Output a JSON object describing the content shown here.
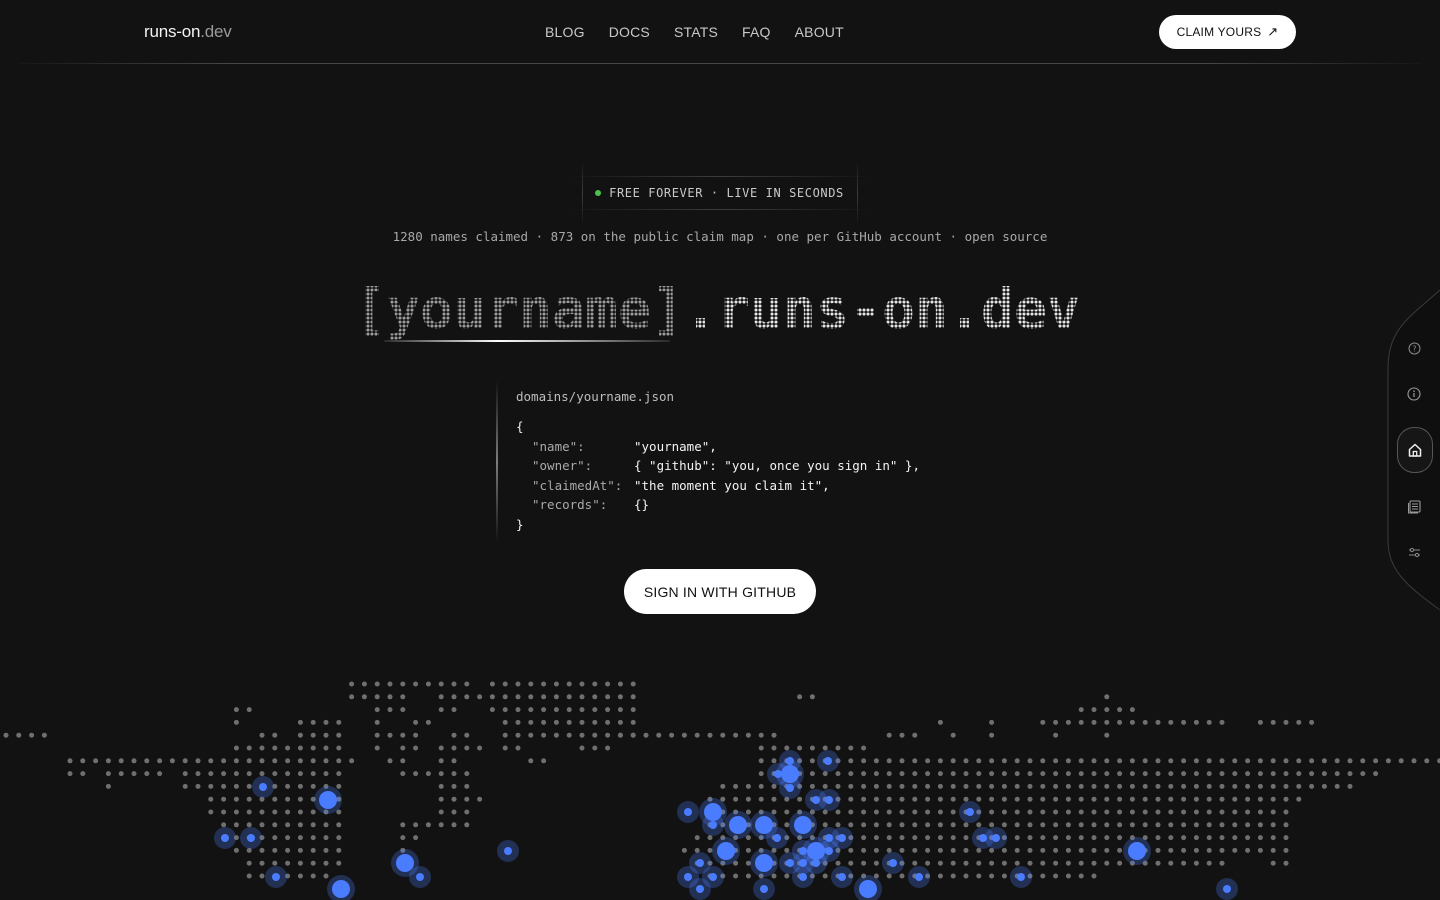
{
  "nav": {
    "logo_main": "runs-on",
    "logo_tld": ".dev",
    "links": [
      "BLOG",
      "DOCS",
      "STATS",
      "FAQ",
      "ABOUT"
    ],
    "cta_label": "CLAIM YOURS",
    "cta_icon": "arrow-up-right-icon"
  },
  "hero": {
    "badge_text": "FREE FOREVER · LIVE IN SECONDS",
    "badge_status_color": "#4cc24c",
    "stats_text": "1280 names claimed · 873 on the public claim map · one per GitHub account · open source",
    "title_placeholder": "[yourname]",
    "title_domain": ".runs-on.dev"
  },
  "code": {
    "filename": "domains/yourname.json",
    "open_brace": "{",
    "close_brace": "}",
    "rows": [
      {
        "key": "\"name\":",
        "value": "\"yourname\","
      },
      {
        "key": "\"owner\":",
        "value": "{ \"github\": \"you, once you sign in\" },"
      },
      {
        "key": "\"claimedAt\":",
        "value": "\"the moment you claim it\","
      },
      {
        "key": "\"records\":",
        "value": "{}"
      }
    ]
  },
  "cta": {
    "signin_label": "SIGN IN WITH GITHUB"
  },
  "rail": {
    "icons": [
      "help-circle-icon",
      "info-icon",
      "home-icon",
      "document-stack-icon",
      "settings-sliders-icon"
    ],
    "active": "home-icon"
  },
  "colors": {
    "background": "#121212",
    "accent_blue": "#4a7cff",
    "dot_gray": "#8a8a8a"
  }
}
